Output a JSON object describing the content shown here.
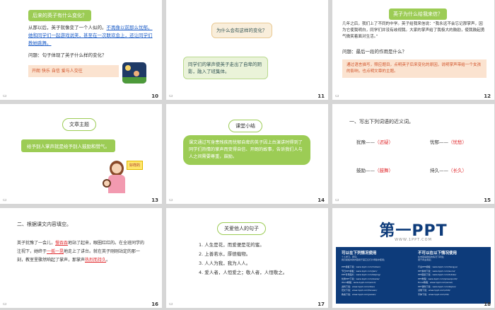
{
  "slides": {
    "s10": {
      "title": "后来的英子有什么变化？",
      "para_a": "从那以后，英子就像变了一个人似的。",
      "para_b": "不再像以前那么忧郁。她和同学们一起游戏说笑，甚至在一次联欢会上，还让同学们教她跳舞。",
      "question": "问题：句子体现了英子什么样的变化？",
      "answer": "开朗  快乐  自信  爱与人交往",
      "page": "10"
    },
    "s11": {
      "bubble_q": "为什么会有这样的变化？",
      "bubble_a": "同学们的掌声使英子走出了自卑的阴影，融入了班集体。",
      "page": "11"
    },
    "s12": {
      "title": "英子为什么给我来信？",
      "body": "几年之后，我们上了不同的中学。英子给我来信说：“我永远不会忘记那掌声，因为它使我明白，同学们并没有歧视我。大家的掌声给了我极大的鼓励，使我鼓起勇气微笑着面对生活。”",
      "question": "问题：最后一段的作用是什么？",
      "answer": "通过语言描写，照应题目，点明英子后来变化的原因，说明掌声带给一个女孩的影响，也点明文章的主题。",
      "page": "12"
    },
    "s13": {
      "title": "文章主题",
      "theme": "给予别人掌声就是给予别人鼓励和赞气。",
      "sign": "好样的",
      "page": "13"
    },
    "s14": {
      "title": "课堂小结",
      "summary": "课文通过写身患残疾而忧郁自卑的英子因上台演讲时得到了同学们热情的掌声而变得自信、开朗的故事，告诉我们人与人之间需要尊重，鼓励。",
      "page": "14"
    },
    "s15": {
      "title": "一、写出下列词语的近义词。",
      "pairs": [
        {
          "word": "犹豫",
          "answer": "（迟疑）"
        },
        {
          "word": "忧郁",
          "answer": "（忧愁）"
        },
        {
          "word": "鼓励",
          "answer": "（鼓舞）"
        },
        {
          "word": "持久",
          "answer": "（长久）"
        }
      ],
      "dash": "——",
      "page": "15"
    },
    "s16": {
      "title": "二、根据课文内容填空。",
      "text1": "英子犹豫了一会儿，",
      "blank1": "慢吞吞",
      "text2": "地站了起来，眼圈红红的。在全班同学的注视下，她终于",
      "blank2": "一摇一晃",
      "text3": "地走上了讲台。就在英子刚刚站定的那一刻，教室里骤然响起了掌声，那掌声",
      "blank3": "热烈而持久",
      "text4": "。",
      "page": "16"
    },
    "s17": {
      "title": "关爱他人的句子",
      "items": [
        "1. 人生是花，而爱便是花的蜜。",
        "2. 上善若水，厚德载物。",
        "3. 人人为我，我为人人。",
        "4. 爱人者，人恒爱之；敬人者，人恒敬之。"
      ],
      "page": "17"
    },
    "s18": {
      "logo": "第一PPT",
      "url": "WWW.1PPT.COM",
      "left_head": "可以在下列情况使用",
      "left_sub": "个人学习、研究；\n拷贝模板中的内容用于其它幻灯片母版中使用；",
      "right_head": "不可以在以下情况使用",
      "right_sub": "在未取得授权的情况下转载；\n用于商业用途；",
      "links_left": [
        "PPT模板下载：www.1ppt.com/moban/",
        "节日PPT模板：www.1ppt.com/jieri/",
        "PPT背景图片：www.1ppt.com/beijing/",
        "优秀PPT下载：www.1ppt.com/xiazai/",
        "Word教程：www.1ppt.com/word/",
        "资料下载：www.1ppt.com/ziliao/",
        "范文下载：www.1ppt.com/fanwen/",
        "教案下载：www.1ppt.com/jiaoan/"
      ],
      "links_right": [
        "行业PPT模板：www.1ppt.com/hangye/",
        "PPT素材下载：www.1ppt.com/sucai/",
        "PPT图表下载：www.1ppt.com/tubiao/",
        "PPT教程：www.1ppt.com/powerpoint/",
        "Excel教程：www.1ppt.com/excel/",
        "PPT课件下载：www.1ppt.com/kejian/",
        "试卷下载：www.1ppt.com/shiti/",
        "字体下载：www.1ppt.com/ziti/"
      ],
      "page": "18"
    }
  },
  "icons": {
    "footer": "notes-icon"
  },
  "colors": {
    "accent": "#9ccc55",
    "red": "#e0262a",
    "blue": "#1f5fc8",
    "orange": "#e58a1f",
    "navy": "#0d3b7a"
  }
}
